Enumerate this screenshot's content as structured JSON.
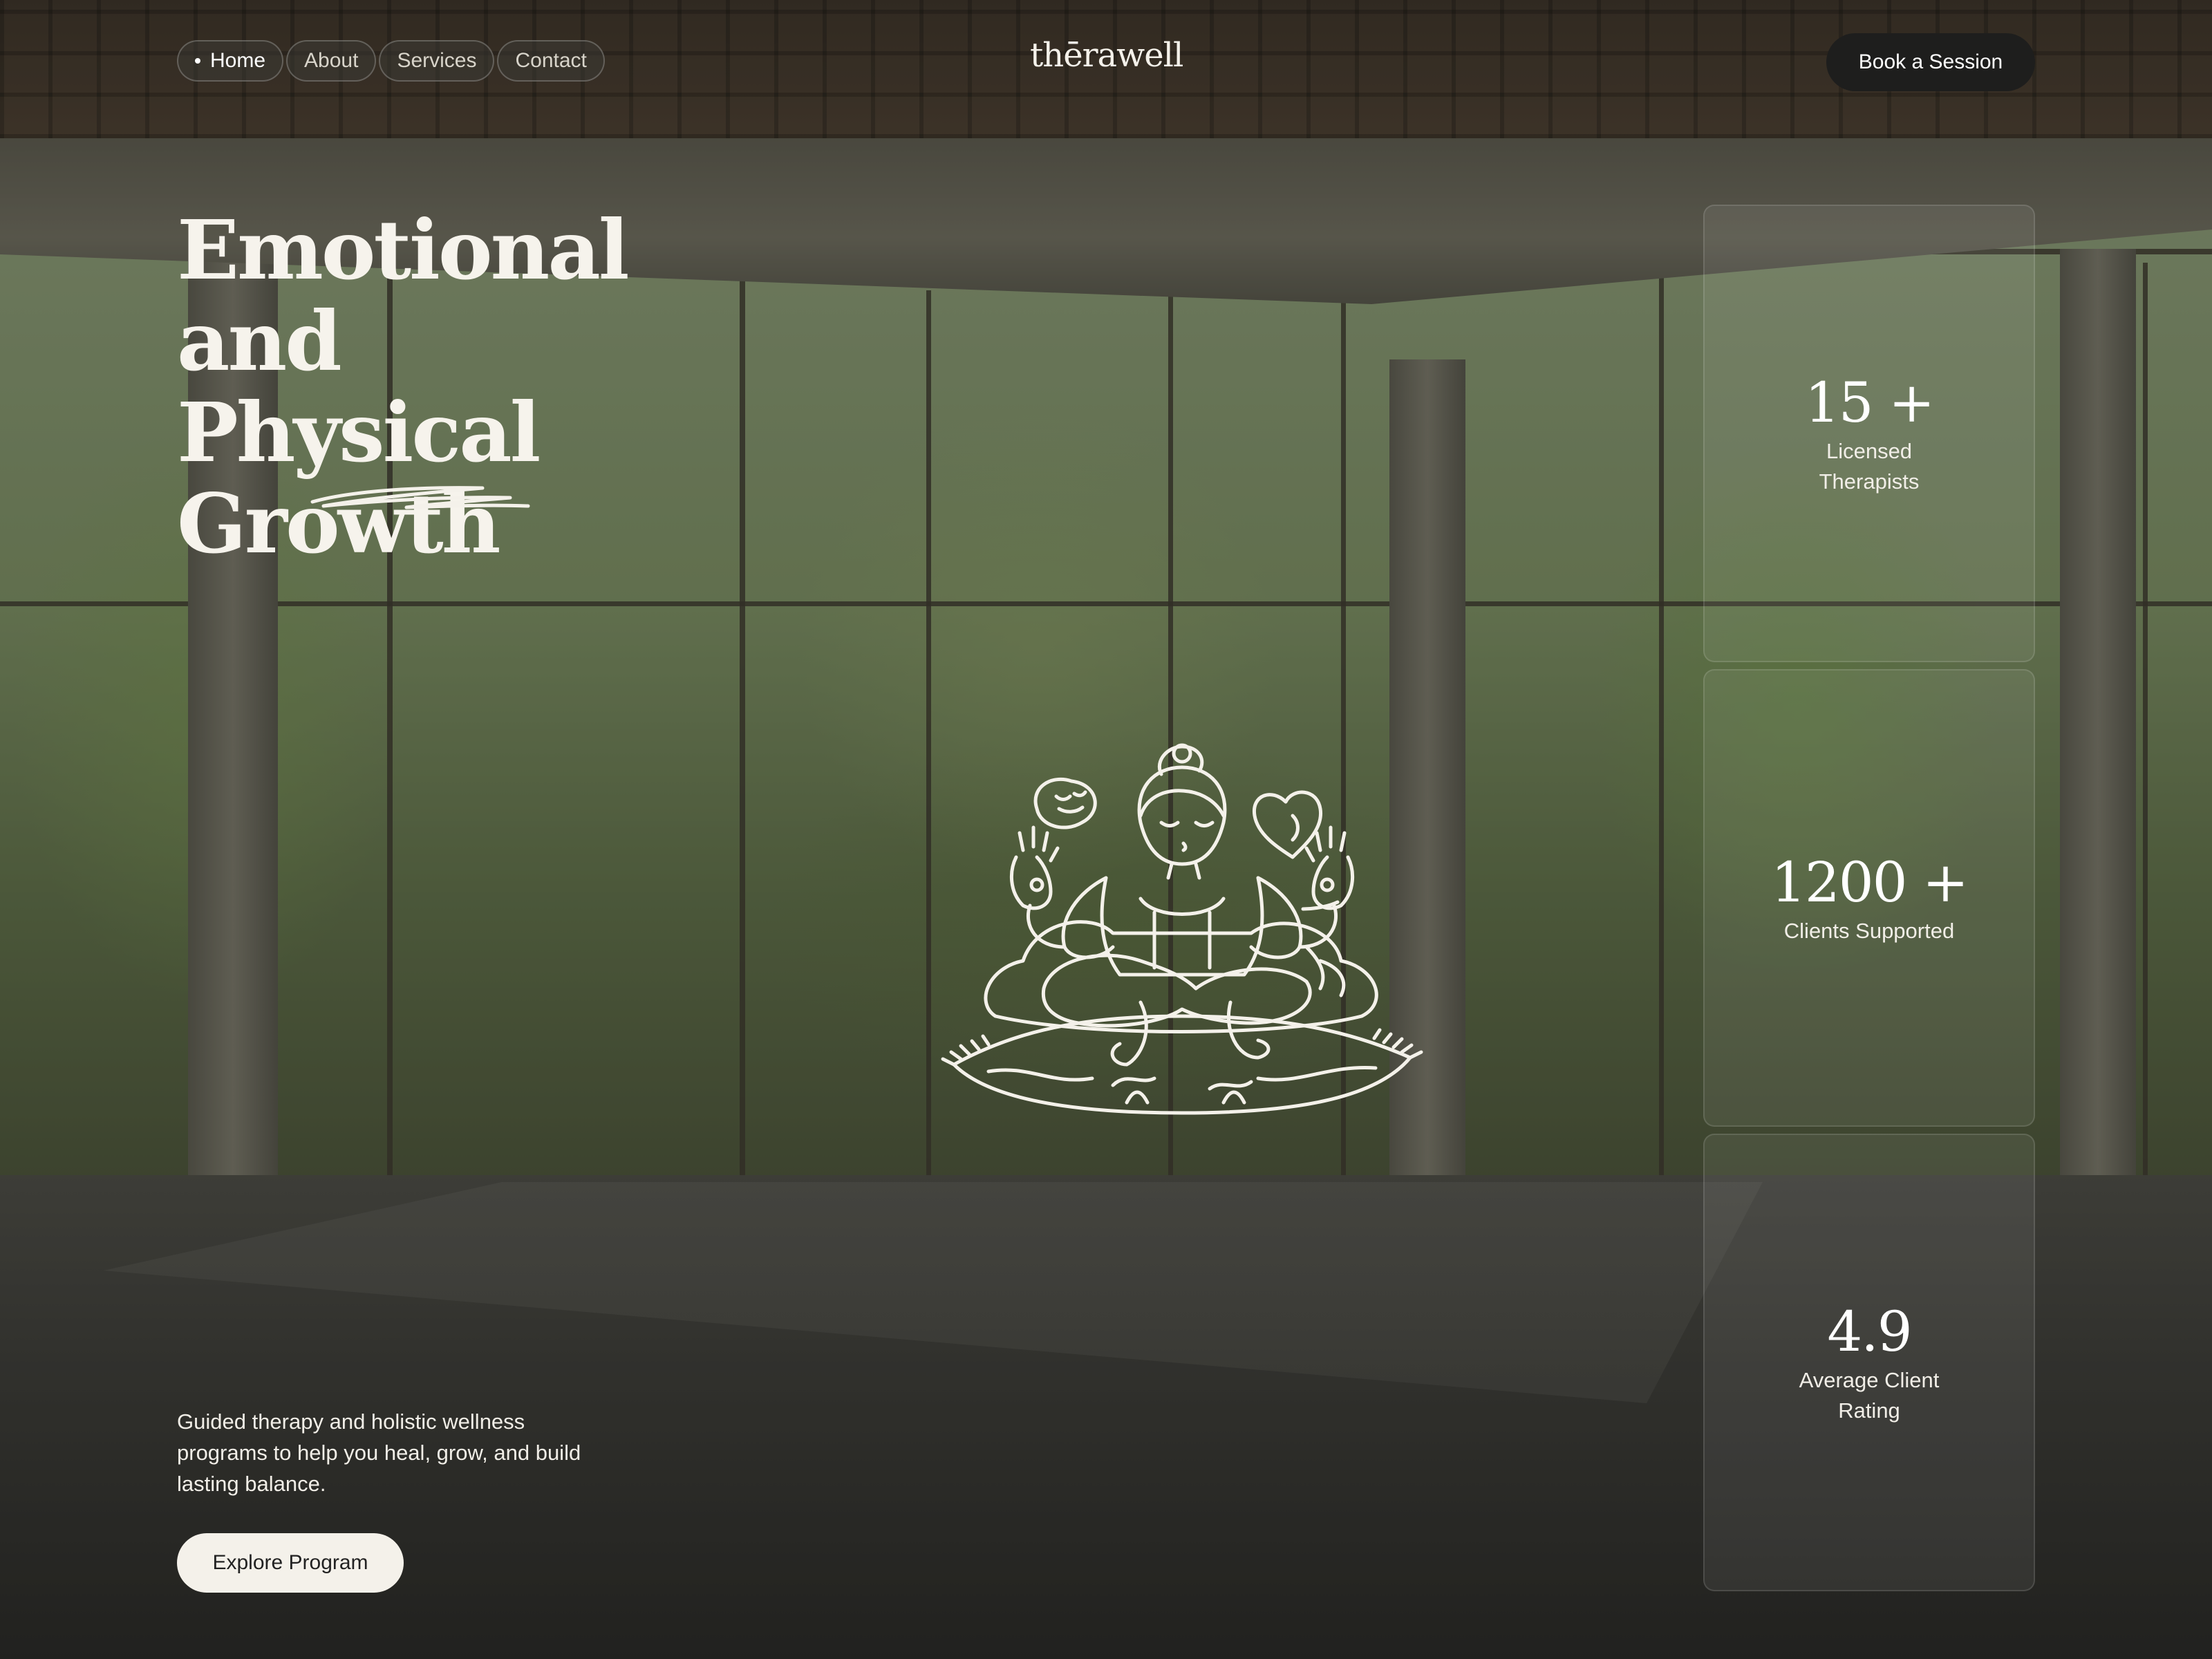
{
  "nav": {
    "items": [
      {
        "label": "Home",
        "active": true
      },
      {
        "label": "About",
        "active": false
      },
      {
        "label": "Services",
        "active": false
      },
      {
        "label": "Contact",
        "active": false
      }
    ]
  },
  "brand": {
    "logo_text": "thērawell"
  },
  "header": {
    "cta_label": "Book a Session"
  },
  "hero": {
    "title_lines": [
      "Emotional",
      "and Physical",
      "Growth"
    ],
    "description": "Guided therapy and holistic wellness programs to help you heal, grow, and build lasting balance.",
    "cta_label": "Explore Program"
  },
  "stats": [
    {
      "value": "15 +",
      "label": "Licensed Therapists"
    },
    {
      "value": "1200 +",
      "label": "Clients Supported"
    },
    {
      "value": "4.9",
      "label": "Average Client Rating"
    }
  ],
  "colors": {
    "text": "#f4f1ea",
    "dark_button": "#1e1e1d",
    "light_button": "#f4f1ea"
  },
  "illustration": {
    "icon": "meditating-person-icon"
  }
}
